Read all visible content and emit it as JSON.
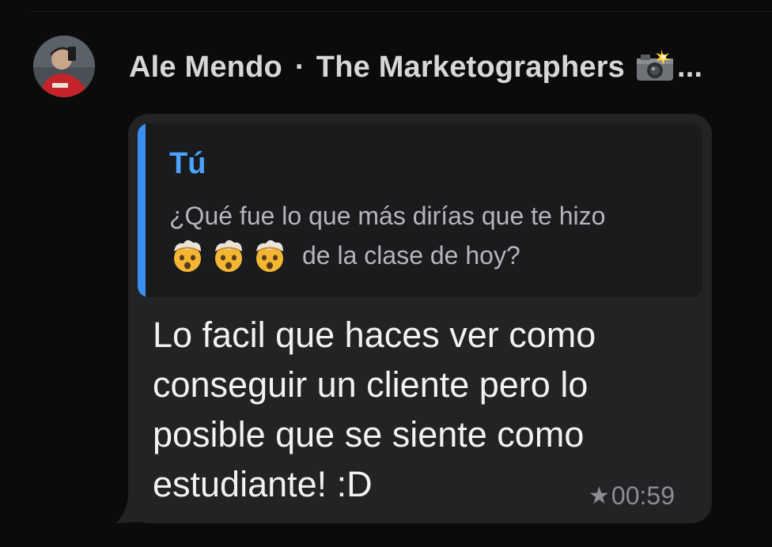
{
  "header": {
    "sender_name": "Ale Mendo",
    "separator": "·",
    "group_name": "The Marketographers",
    "camera_icon": "camera-flash-icon",
    "ellipsis": "..."
  },
  "message": {
    "reply": {
      "author": "Tú",
      "text_line1": "¿Qué fue lo que más dirías que te hizo",
      "emoji_icon": "exploding-head-emoji",
      "emoji_count": 3,
      "text_line2": "de la clase de hoy?"
    },
    "body_lines": [
      "Lo facil que haces ver como",
      "conseguir un cliente pero lo",
      "posible que se siente como",
      "estudiante! :D"
    ],
    "star": "★",
    "time": "00:59"
  },
  "colors": {
    "background": "#0b0b0c",
    "bubble": "#222325",
    "quote_background": "#1a1b1d",
    "quote_accent": "#3b8ff0",
    "quote_author": "#4da1ff"
  }
}
